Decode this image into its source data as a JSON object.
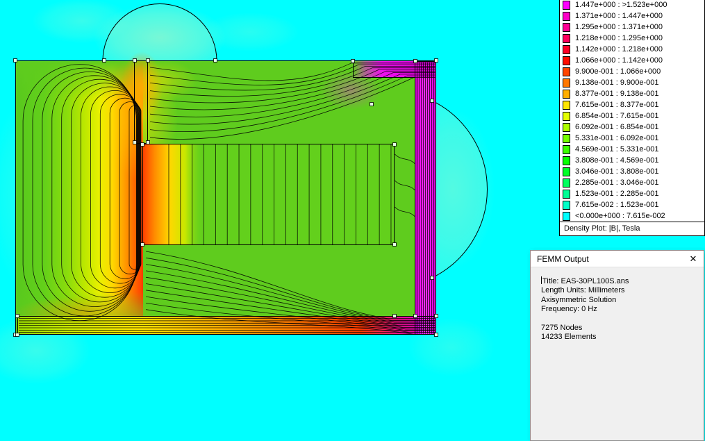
{
  "app": {
    "background_color": "#00FFFF"
  },
  "legend": {
    "caption": "Density Plot: |B|, Tesla",
    "entries": [
      {
        "color": "#FF00FF",
        "label": "1.447e+000 : >1.523e+000"
      },
      {
        "color": "#FF00C8",
        "label": "1.371e+000 : 1.447e+000"
      },
      {
        "color": "#FF0095",
        "label": "1.295e+000 : 1.371e+000"
      },
      {
        "color": "#FF005E",
        "label": "1.218e+000 : 1.295e+000"
      },
      {
        "color": "#FF0026",
        "label": "1.142e+000 : 1.218e+000"
      },
      {
        "color": "#FF0D00",
        "label": "1.066e+000 : 1.142e+000"
      },
      {
        "color": "#FF4400",
        "label": "9.900e-001 : 1.066e+000"
      },
      {
        "color": "#FF7700",
        "label": "9.138e-001 : 9.900e-001"
      },
      {
        "color": "#FFAE00",
        "label": "8.377e-001 : 9.138e-001"
      },
      {
        "color": "#FFE600",
        "label": "7.615e-001 : 8.377e-001"
      },
      {
        "color": "#E4FF00",
        "label": "6.854e-001 : 7.615e-001"
      },
      {
        "color": "#ADFF00",
        "label": "6.092e-001 : 6.854e-001"
      },
      {
        "color": "#75FF00",
        "label": "5.331e-001 : 6.092e-001"
      },
      {
        "color": "#3DFF00",
        "label": "4.569e-001 : 5.331e-001"
      },
      {
        "color": "#08FF00",
        "label": "3.808e-001 : 4.569e-001"
      },
      {
        "color": "#00FF26",
        "label": "3.046e-001 : 3.808e-001"
      },
      {
        "color": "#00FF5E",
        "label": "2.285e-001 : 3.046e-001"
      },
      {
        "color": "#00FF95",
        "label": "1.523e-001 : 2.285e-001"
      },
      {
        "color": "#00FFC8",
        "label": "7.615e-002 : 1.523e-001"
      },
      {
        "color": "#00FFFF",
        "label": "<0.000e+000 : 7.615e-002"
      }
    ]
  },
  "output_window": {
    "title": "FEMM Output",
    "close_icon": "✕",
    "lines": [
      "Title: EAS-30PL100S.ans",
      "Length Units: Millimeters",
      "Axisymmetric Solution",
      "Frequency: 0 Hz",
      "",
      "7275 Nodes",
      "14233 Elements"
    ]
  }
}
